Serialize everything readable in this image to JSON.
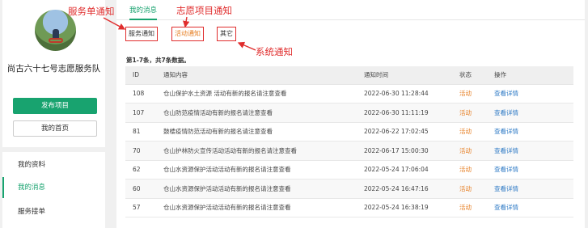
{
  "sidebar": {
    "org_name": "尚古六十七号志愿服务队",
    "publish_button": "发布项目",
    "home_button": "我的首页",
    "menu": [
      {
        "label": "我的资料"
      },
      {
        "label": "我的消息"
      },
      {
        "label": "服务接单"
      }
    ]
  },
  "main": {
    "active_tab": "我的消息",
    "filters": {
      "service": "服务通知",
      "activity": "活动通知",
      "other": "其它"
    },
    "summary": "第1-7条，共7条数据。",
    "table": {
      "headers": [
        "ID",
        "通知内容",
        "通知时间",
        "状态",
        "操作"
      ],
      "rows": [
        {
          "id": "108",
          "content": "仓山保护水土资源 活动有新的报名请注意查看",
          "time": "2022-06-30 11:28:44",
          "status": "活动",
          "action": "查看详情"
        },
        {
          "id": "107",
          "content": "仓山防范疫情活动有新的报名请注意查看",
          "time": "2022-06-30 11:11:19",
          "status": "活动",
          "action": "查看详情"
        },
        {
          "id": "81",
          "content": "鼓楼疫情防范活动有新的报名请注意查看",
          "time": "2022-06-22 17:02:45",
          "status": "活动",
          "action": "查看详情"
        },
        {
          "id": "70",
          "content": "仓山护林防火宣传活动活动有新的报名请注意查看",
          "time": "2022-06-17 15:00:30",
          "status": "活动",
          "action": "查看详情"
        },
        {
          "id": "62",
          "content": "仓山水资源保护活动活动有新的报名请注意查看",
          "time": "2022-05-24 17:06:04",
          "status": "活动",
          "action": "查看详情"
        },
        {
          "id": "60",
          "content": "仓山水资源保护活动活动有新的报名请注意查看",
          "time": "2022-05-24 16:47:16",
          "status": "活动",
          "action": "查看详情"
        },
        {
          "id": "57",
          "content": "仓山水资源保护活动活动有新的报名请注意查看",
          "time": "2022-05-24 16:38:19",
          "status": "活动",
          "action": "查看详情"
        }
      ]
    }
  },
  "annotations": {
    "service": "服务单通知",
    "volunteer": "志愿项目通知",
    "system": "系统通知"
  },
  "colors": {
    "accent": "#18a36f",
    "annotation": "#e02d2d",
    "status": "#e67e22",
    "link": "#2b78c5"
  }
}
